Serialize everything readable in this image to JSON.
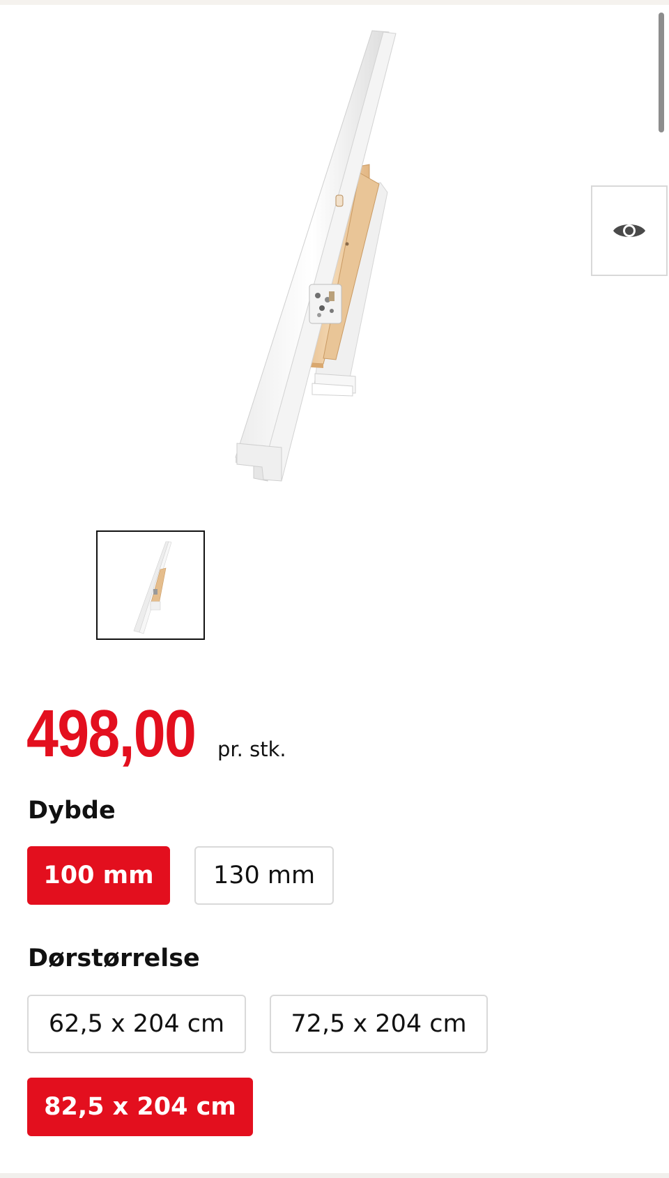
{
  "product": {
    "image_icon": "door-frame-kit-image",
    "thumbnail_icon": "door-frame-kit-thumbnail",
    "view_icon": "eye-icon"
  },
  "price": {
    "amount": "498,00",
    "unit": "pr. stk.",
    "color": "#e30f1e"
  },
  "depth": {
    "title": "Dybde",
    "options": [
      {
        "label": "100 mm",
        "selected": true
      },
      {
        "label": "130 mm",
        "selected": false
      }
    ]
  },
  "door_size": {
    "title": "Dørstørrelse",
    "options": [
      {
        "label": "62,5 x 204 cm",
        "selected": false
      },
      {
        "label": "72,5 x 204 cm",
        "selected": false
      },
      {
        "label": "82,5 x 204 cm",
        "selected": true
      }
    ]
  },
  "colors": {
    "accent": "#e30f1e",
    "border": "#d9d9d9",
    "text": "#111111"
  }
}
